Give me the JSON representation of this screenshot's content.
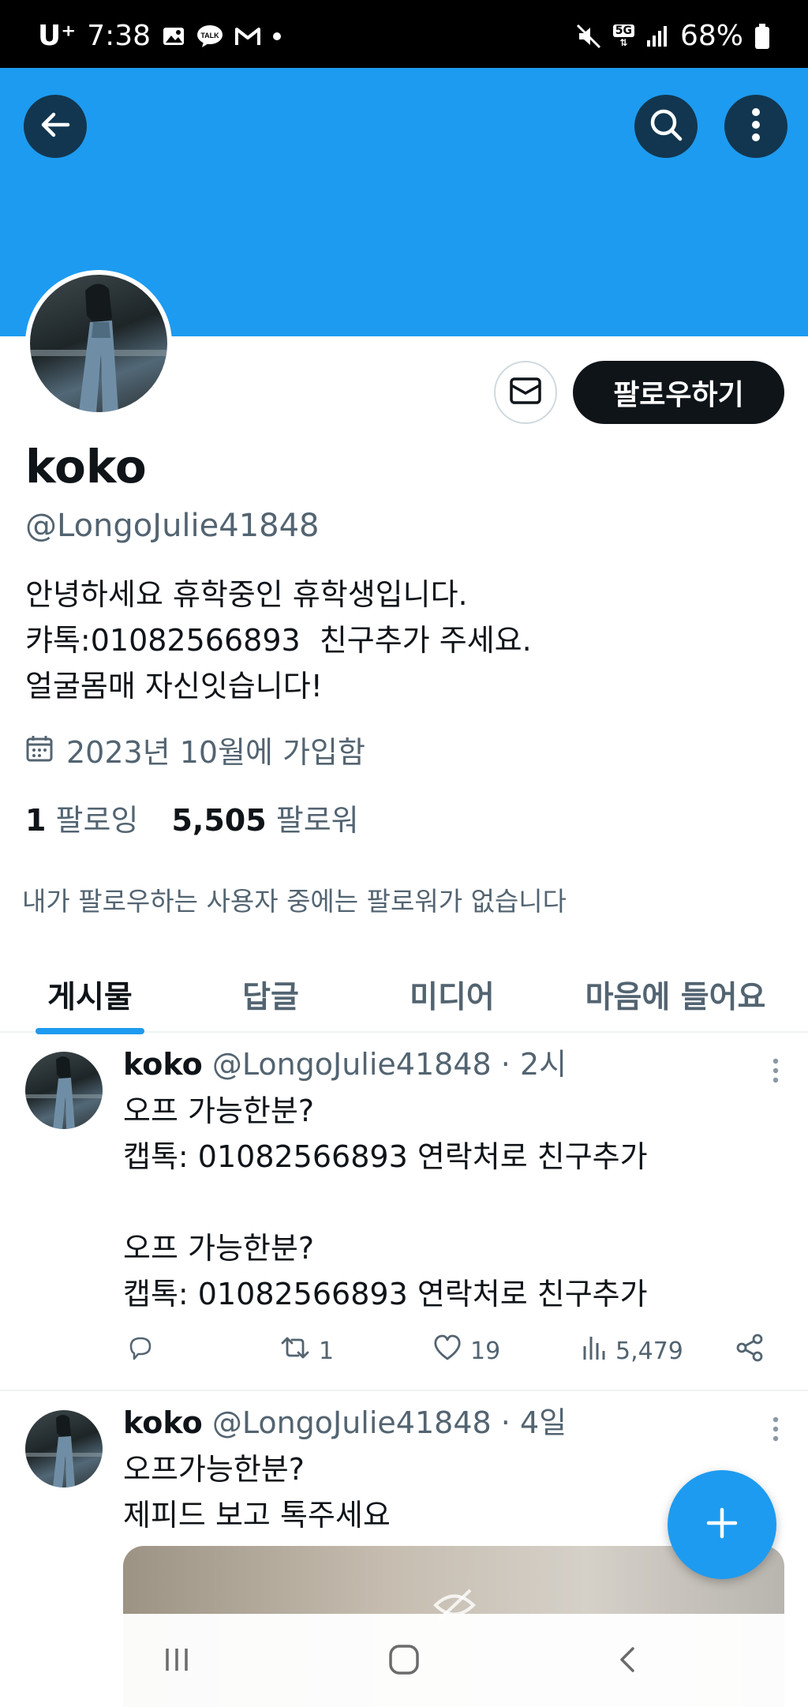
{
  "status_bar": {
    "carrier": "U⁺",
    "time": "7:38",
    "network": "5G",
    "battery": "68%",
    "icons_left": [
      "gallery-icon",
      "talk-icon",
      "gmail-icon",
      "dot-icon"
    ],
    "icons_right": [
      "mute-icon",
      "network-5g-icon",
      "signal-icon",
      "battery-icon"
    ]
  },
  "header": {
    "back_icon": "arrow-left-icon",
    "search_icon": "search-icon",
    "more_icon": "more-vertical-icon",
    "banner_color": "#1d9bf0"
  },
  "profile": {
    "name": "koko",
    "handle": "@LongoJulie41848",
    "bio": [
      "안녕하세요 휴학중인 휴학생입니다.",
      "캬톡:01082566893  친구추가 주세요.",
      "얼굴몸매 자신잇습니다!"
    ],
    "joined": "2023년 10월에 가입함",
    "following_count": "1",
    "following_label": "팔로잉",
    "followers_count": "5,505",
    "followers_label": "팔로워",
    "no_mutual": "내가 팔로우하는 사용자 중에는 팔로워가 없습니다",
    "follow_button": "팔로우하기",
    "message_icon": "mail-icon"
  },
  "tabs": [
    {
      "label": "게시물",
      "active": true
    },
    {
      "label": "답글",
      "active": false
    },
    {
      "label": "미디어",
      "active": false
    },
    {
      "label": "마음에 들어요",
      "active": false
    }
  ],
  "posts": [
    {
      "name": "koko",
      "handle": "@LongoJulie41848",
      "time": "· 2시",
      "lines": [
        "오프 가능한분?",
        "캡톡: 01082566893 연락처로 친구추가",
        "",
        "오프 가능한분?",
        "캡톡: 01082566893 연락처로 친구추가"
      ],
      "replies": "",
      "retweets": "1",
      "likes": "19",
      "views": "5,479"
    },
    {
      "name": "koko",
      "handle": "@LongoJulie41848",
      "time": "· 4일",
      "lines": [
        "오프가능한분?",
        "제피드 보고 톡주세요"
      ]
    }
  ],
  "fab_icon": "plus-icon",
  "nav_bar": [
    "recents-icon",
    "home-icon",
    "back-icon"
  ],
  "colors": {
    "accent": "#1d9bf0",
    "text": "#0f1419",
    "secondary": "#536471"
  }
}
